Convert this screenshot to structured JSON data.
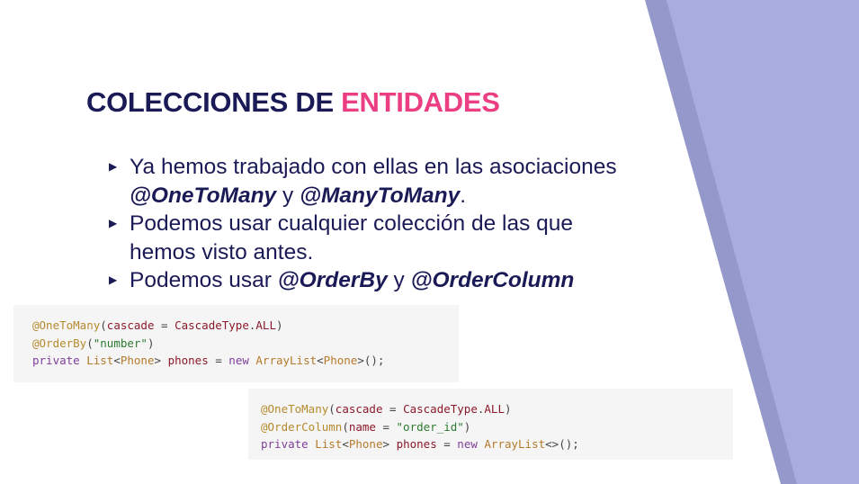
{
  "slide": {
    "title_main": "COLECCIONES DE ",
    "title_accent": "ENTIDADES",
    "colors": {
      "navy": "#1a1a57",
      "pink": "#ec3f83",
      "band_light": "#a9acde",
      "band_dark": "#9598cb"
    }
  },
  "bullets": [
    {
      "text_pre": "Ya hemos trabajado con ellas en las asociaciones ",
      "em1": "@OneToMany",
      "mid": " y ",
      "em2": "@ManyToMany",
      "post": "."
    },
    {
      "text": "Podemos usar cualquier colección de las que hemos visto antes."
    },
    {
      "text_pre": "Podemos usar ",
      "em1": "@OrderBy",
      "mid": " y ",
      "em2": "@OrderColumn"
    }
  ],
  "bullet_icon": "triangle-right-icon",
  "code_orderby": {
    "l1": {
      "ann": "@OneToMany",
      "open": "(",
      "var": "cascade",
      "eq": " = ",
      "type": "CascadeType",
      "dot": ".",
      "const": "ALL",
      "close": ")"
    },
    "l2": {
      "ann": "@OrderBy",
      "open": "(",
      "str": "\"number\"",
      "close": ")"
    },
    "l3": {
      "kw1": "private",
      "sp1": " ",
      "t1": "List",
      "lt": "<",
      "t2": "Phone",
      "gt": ">",
      "sp2": " ",
      "var": "phones",
      "eq": " = ",
      "kw2": "new",
      "sp3": " ",
      "t3": "ArrayList",
      "lt2": "<",
      "t4": "Phone",
      "end": ">();"
    }
  },
  "code_ordercolumn": {
    "l1": {
      "ann": "@OneToMany",
      "open": "(",
      "var": "cascade",
      "eq": " = ",
      "type": "CascadeType",
      "dot": ".",
      "const": "ALL",
      "close": ")"
    },
    "l2": {
      "ann": "@OrderColumn",
      "open": "(",
      "var": "name",
      "eq": " = ",
      "str": "\"order_id\"",
      "close": ")"
    },
    "l3": {
      "kw1": "private",
      "sp1": " ",
      "t1": "List",
      "lt": "<",
      "t2": "Phone",
      "gt": ">",
      "sp2": " ",
      "var": "phones",
      "eq": " = ",
      "kw2": "new",
      "sp3": " ",
      "t3": "ArrayList",
      "end": "<>();"
    }
  }
}
